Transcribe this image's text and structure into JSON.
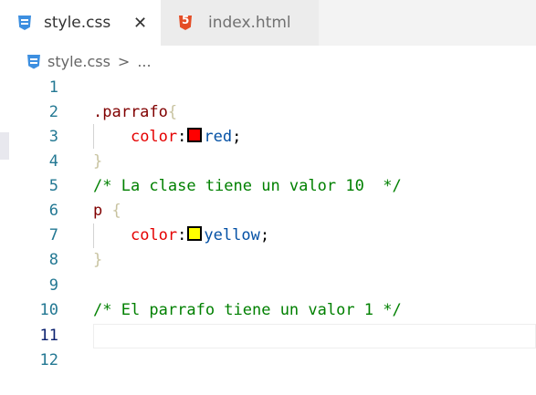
{
  "tabs": [
    {
      "label": "style.css",
      "icon": "css-icon",
      "active": true
    },
    {
      "label": "index.html",
      "icon": "html5-icon",
      "active": false
    }
  ],
  "breadcrumb": {
    "file": "style.css",
    "separator": ">",
    "more": "..."
  },
  "editor": {
    "line_numbers": [
      "1",
      "2",
      "3",
      "4",
      "5",
      "6",
      "7",
      "8",
      "9",
      "10",
      "11",
      "12"
    ],
    "current_line": 11,
    "code": {
      "l2_selector": ".parrafo",
      "open": "{",
      "close": "}",
      "l3_prop": "color",
      "colon": ":",
      "l3_value": "red",
      "semi": ";",
      "l5_comment": "/* La clase tiene un valor 10  */",
      "l6_selector": "p ",
      "l7_prop": "color",
      "l7_value": "yellow",
      "l10_comment": "/* El parrafo tiene un valor 1 */"
    },
    "swatches": {
      "red": "#ff0000",
      "yellow": "#ffff00"
    }
  }
}
